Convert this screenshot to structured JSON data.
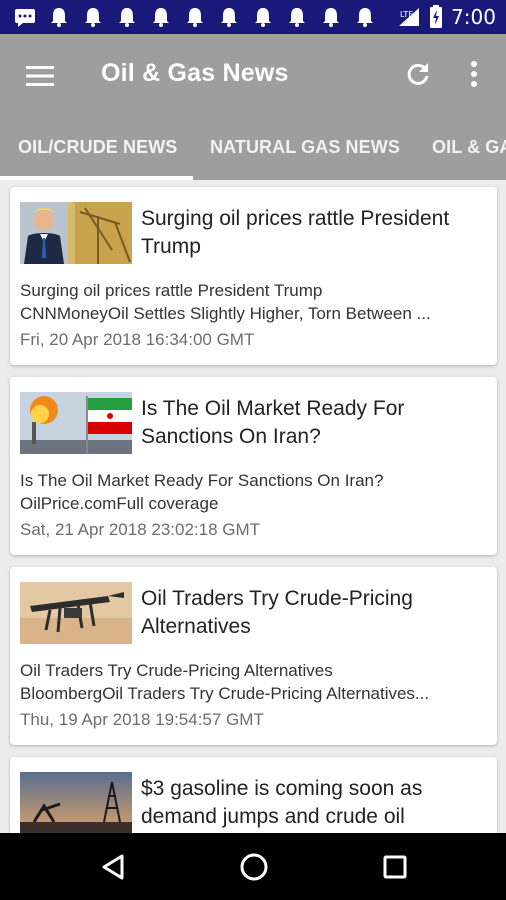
{
  "status_bar": {
    "time": "7:00",
    "network": "LTE",
    "notification_icons": [
      "message-icon",
      "bell-icon",
      "bell-icon",
      "bell-icon",
      "bell-icon",
      "bell-icon",
      "bell-icon",
      "bell-icon",
      "bell-icon",
      "bell-icon",
      "bell-icon"
    ]
  },
  "app_bar": {
    "title": "Oil & Gas News",
    "background": "#9e9e9e"
  },
  "tabs": [
    {
      "label": "OIL/CRUDE NEWS",
      "selected": true
    },
    {
      "label": "NATURAL GAS NEWS",
      "selected": false
    },
    {
      "label": "OIL & GA",
      "selected": false
    }
  ],
  "articles": [
    {
      "headline": "Surging oil prices rattle President Trump",
      "desc_line1": "Surging oil prices rattle President Trump",
      "desc_line2": "CNNMoneyOil Settles Slightly Higher, Torn Between ...",
      "date": "Fri, 20 Apr 2018 16:34:00 GMT"
    },
    {
      "headline": "Is The Oil Market Ready For Sanctions On Iran?",
      "desc_line1": "Is The Oil Market Ready For Sanctions On Iran?",
      "desc_line2": "OilPrice.comFull coverage",
      "date": "Sat, 21 Apr 2018 23:02:18 GMT"
    },
    {
      "headline": "Oil Traders Try Crude-Pricing Alternatives",
      "desc_line1": "Oil Traders Try Crude-Pricing Alternatives",
      "desc_line2": "BloombergOil Traders Try Crude-Pricing Alternatives...",
      "date": "Thu, 19 Apr 2018 19:54:57 GMT"
    },
    {
      "headline": "$3 gasoline is coming soon as demand jumps and crude oil",
      "desc_line1": "",
      "desc_line2": "",
      "date": ""
    }
  ],
  "colors": {
    "status_bar": "#19197a",
    "app_bar": "#9e9e9e",
    "feed_background": "#ececec",
    "nav_bar": "#000000"
  }
}
